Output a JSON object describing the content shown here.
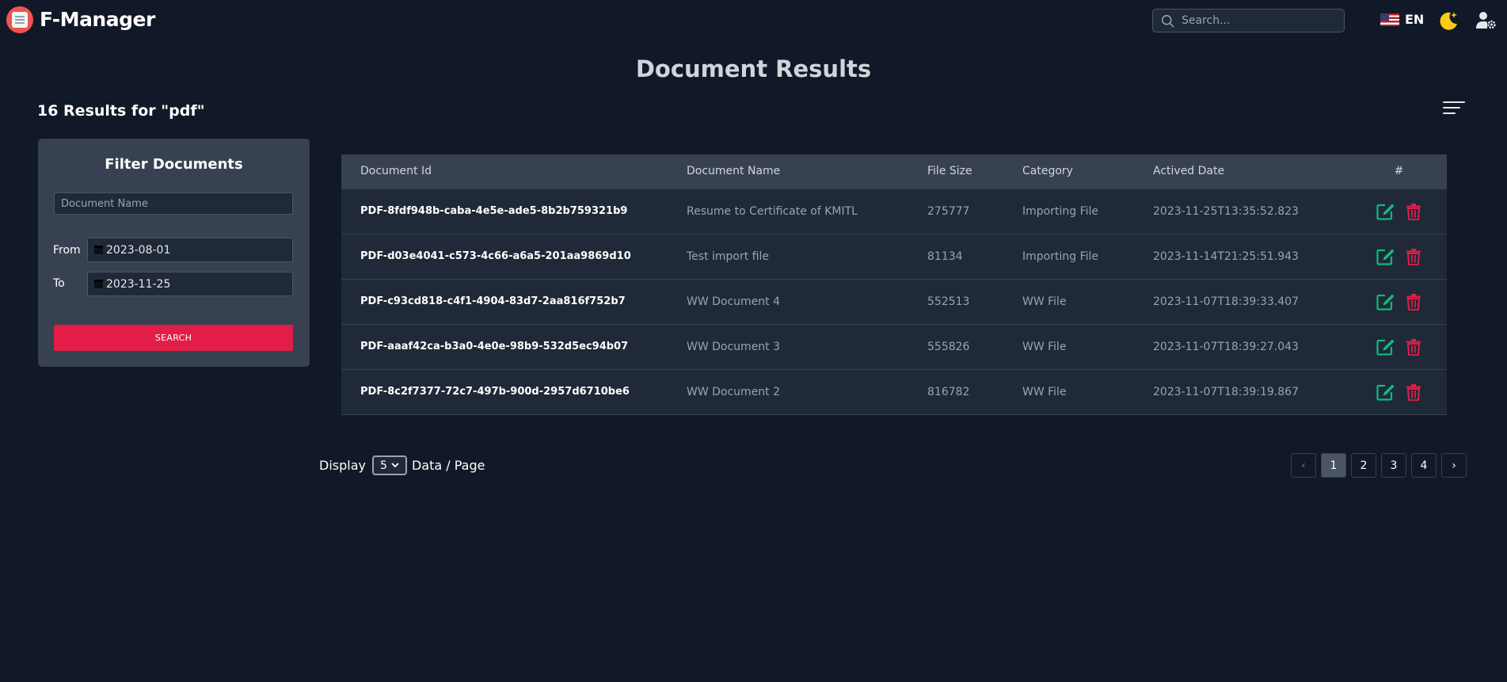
{
  "app": {
    "brand": "F-Manager"
  },
  "header": {
    "search_placeholder": "Search...",
    "language": "EN",
    "flag_icon": "us-flag-icon",
    "theme_icon": "moon-icon",
    "user_icon": "user-settings-icon"
  },
  "page": {
    "title": "Document Results",
    "results_count": "16 Results for \"pdf\""
  },
  "filter": {
    "title": "Filter Documents",
    "name_placeholder": "Document Name",
    "from_label": "From",
    "from_value": "2023-08-01",
    "to_label": "To",
    "to_value": "2023-11-25",
    "search_label": "SEARCH"
  },
  "table": {
    "columns": [
      "Document Id",
      "Document Name",
      "File Size",
      "Category",
      "Actived Date",
      "#"
    ],
    "rows": [
      {
        "id": "PDF-8fdf948b-caba-4e5e-ade5-8b2b759321b9",
        "name": "Resume to Certificate of KMITL",
        "size": "275777",
        "category": "Importing File",
        "date": "2023-11-25T13:35:52.823"
      },
      {
        "id": "PDF-d03e4041-c573-4c66-a6a5-201aa9869d10",
        "name": "Test import file",
        "size": "81134",
        "category": "Importing File",
        "date": "2023-11-14T21:25:51.943"
      },
      {
        "id": "PDF-c93cd818-c4f1-4904-83d7-2aa816f752b7",
        "name": "WW Document 4",
        "size": "552513",
        "category": "WW File",
        "date": "2023-11-07T18:39:33.407"
      },
      {
        "id": "PDF-aaaf42ca-b3a0-4e0e-98b9-532d5ec94b07",
        "name": "WW Document 3",
        "size": "555826",
        "category": "WW File",
        "date": "2023-11-07T18:39:27.043"
      },
      {
        "id": "PDF-8c2f7377-72c7-497b-900d-2957d6710be6",
        "name": "WW Document 2",
        "size": "816782",
        "category": "WW File",
        "date": "2023-11-07T18:39:19.867"
      }
    ]
  },
  "pagination": {
    "display_label": "Display",
    "page_size": "5",
    "suffix_label": "Data / Page",
    "pages": [
      "1",
      "2",
      "3",
      "4"
    ],
    "current_page": "1",
    "prev_symbol": "‹",
    "next_symbol": "›"
  },
  "colors": {
    "background": "#111827",
    "panel": "#374151",
    "accent_red": "#e11d48",
    "edit_green": "#10b981",
    "theme_yellow": "#facc15"
  }
}
